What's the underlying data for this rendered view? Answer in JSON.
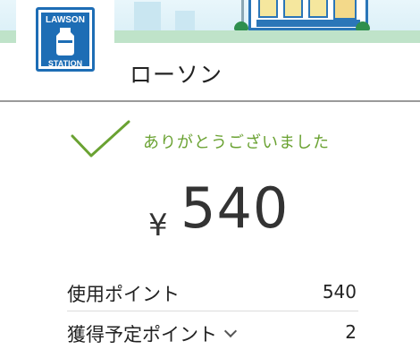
{
  "store": {
    "name": "ローソン",
    "logo_text_top": "LAWSON",
    "logo_text_bottom": "STATION",
    "brand_color": "#1d6db5"
  },
  "receipt": {
    "message": "ありがとうございました",
    "message_color": "#6aa232",
    "currency_symbol": "¥",
    "amount": "540"
  },
  "points": [
    {
      "label": "使用ポイント",
      "value": "540",
      "expandable": false
    },
    {
      "label": "獲得予定ポイント",
      "value": "2",
      "expandable": true
    }
  ]
}
